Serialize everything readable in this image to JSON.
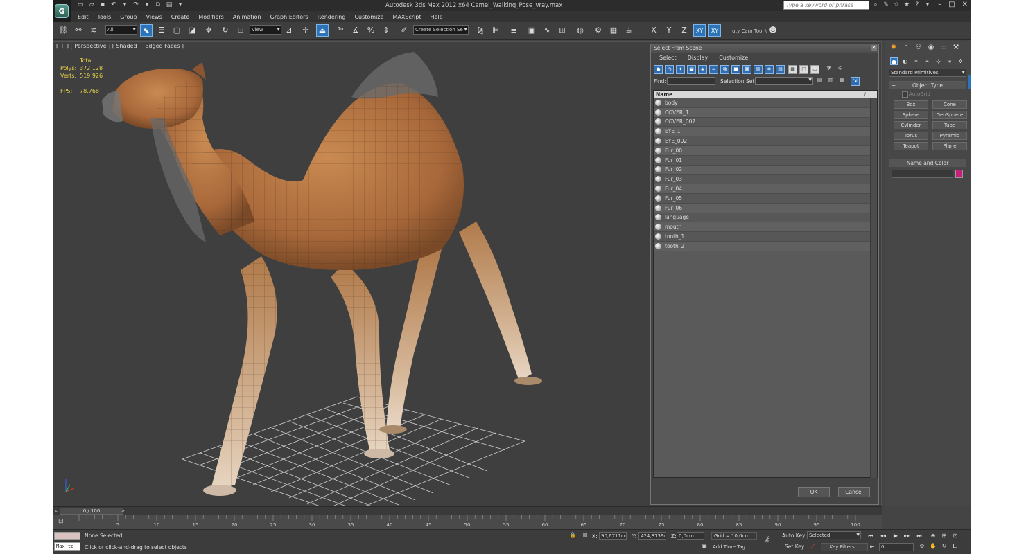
{
  "app": {
    "logo_letter": "G",
    "title": "Autodesk 3ds Max  2012 x64     Camel_Walking_Pose_vray.max",
    "search_placeholder": "Type a keyword or phrase"
  },
  "menu": [
    "Edit",
    "Tools",
    "Group",
    "Views",
    "Create",
    "Modifiers",
    "Animation",
    "Graph Editors",
    "Rendering",
    "Customize",
    "MAXScript",
    "Help"
  ],
  "toolbar": {
    "filter_value": "All",
    "refcoord_value": "View",
    "selection_set_placeholder": "Create Selection Se",
    "cam_tool_label": "uty Cam Tool \\",
    "axis_x": "X",
    "axis_y": "Y",
    "axis_z": "Z",
    "axis_xy": "XY",
    "axis_xy2": "XY"
  },
  "viewport": {
    "label": "[ + ] [ Perspective ] [ Shaded + Edged Faces ]",
    "stats": {
      "total_label": "Total",
      "polys_label": "Polys:",
      "polys_value": "372 128",
      "verts_label": "Verts:",
      "verts_value": "519 926",
      "fps_label": "FPS:",
      "fps_value": "78,768"
    }
  },
  "dialog": {
    "title": "Select From Scene",
    "menu": [
      "Select",
      "Display",
      "Customize"
    ],
    "find_label": "Find:",
    "selection_set_label": "Selection Set:",
    "column_name": "Name",
    "sort_mark": "/",
    "objects": [
      "body",
      "COVER_1",
      "COVER_002",
      "EYE_1",
      "EYE_002",
      "Fur_00",
      "Fur_01",
      "Fur_02",
      "Fur_03",
      "Fur_04",
      "Fur_05",
      "Fur_06",
      "language",
      "mouth",
      "tooth_1",
      "tooth_2"
    ],
    "ok_label": "OK",
    "cancel_label": "Cancel"
  },
  "command_panel": {
    "category_value": "Standard Primitives",
    "object_type_title": "Object Type",
    "autogrid_label": "AutoGrid",
    "buttons": [
      "Box",
      "Cone",
      "Sphere",
      "GeoSphere",
      "Cylinder",
      "Tube",
      "Torus",
      "Pyramid",
      "Teapot",
      "Plane"
    ],
    "name_color_title": "Name and Color",
    "object_color": "#c61f7a"
  },
  "timeline": {
    "frame_display": "0 / 100",
    "ticks": [
      "5",
      "10",
      "15",
      "20",
      "25",
      "30",
      "35",
      "40",
      "45",
      "50",
      "55",
      "60",
      "65",
      "70",
      "75",
      "80",
      "85",
      "90",
      "95",
      "100"
    ]
  },
  "status": {
    "maxscript_label": "Max to",
    "selection_msg": "None Selected",
    "prompt_msg": "Click or click-and-drag to select objects",
    "x_label": "X:",
    "x_value": "90,6711cm",
    "y_label": "Y:",
    "y_value": "424,8139c",
    "z_label": "Z:",
    "z_value": "0,0cm",
    "grid_value": "Grid = 10,0cm",
    "add_time_tag": "Add Time Tag",
    "auto_key": "Auto Key",
    "set_key": "Set Key",
    "selected_value": "Selected",
    "key_filters": "Key Filters...",
    "current_frame": "0"
  }
}
